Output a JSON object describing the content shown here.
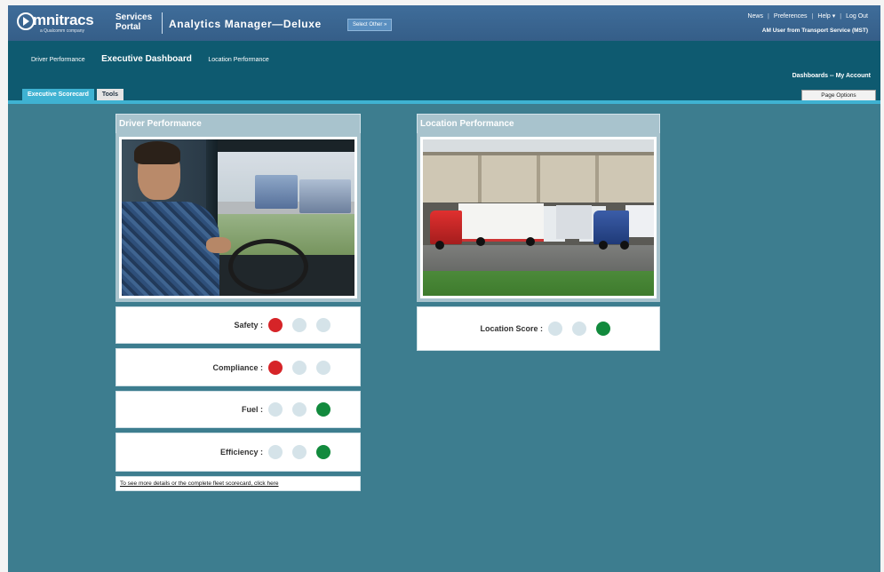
{
  "header": {
    "logo_text": "mnitracs",
    "logo_subtext": "a Qualcomm company",
    "portal_label": "Services Portal",
    "app_title": "Analytics Manager—Deluxe",
    "select_other_label": "Select Other »",
    "links": [
      "News",
      "Preferences",
      "Help ▾",
      "Log Out"
    ],
    "user_line": "AM User from Transport Service (MST)"
  },
  "subnav": {
    "items": [
      "Driver Performance",
      "Executive Dashboard",
      "Location Performance"
    ],
    "active": "Executive Dashboard"
  },
  "dashboard_links": "Dashboards -- My Account",
  "tabs": [
    {
      "label": "Executive Scorecard",
      "active": true
    },
    {
      "label": "Tools",
      "active": false
    }
  ],
  "page_options_label": "Page Options",
  "driver_panel": {
    "title": "Driver Performance",
    "scores": [
      {
        "label": "Safety :",
        "lights": [
          "red",
          "off",
          "off"
        ]
      },
      {
        "label": "Compliance :",
        "lights": [
          "red",
          "off",
          "off"
        ]
      },
      {
        "label": "Fuel :",
        "lights": [
          "off",
          "off",
          "green"
        ]
      },
      {
        "label": "Efficiency :",
        "lights": [
          "off",
          "off",
          "green"
        ]
      }
    ],
    "details_link": "To see more details or the complete fleet scorecard, click here"
  },
  "location_panel": {
    "title": "Location Performance",
    "score": {
      "label": "Location Score :",
      "lights": [
        "off",
        "off",
        "green"
      ]
    }
  },
  "colors": {
    "red": "#d62428",
    "green": "#128a3d",
    "off": "#d5e3e9",
    "accent": "#3fb2d2"
  }
}
